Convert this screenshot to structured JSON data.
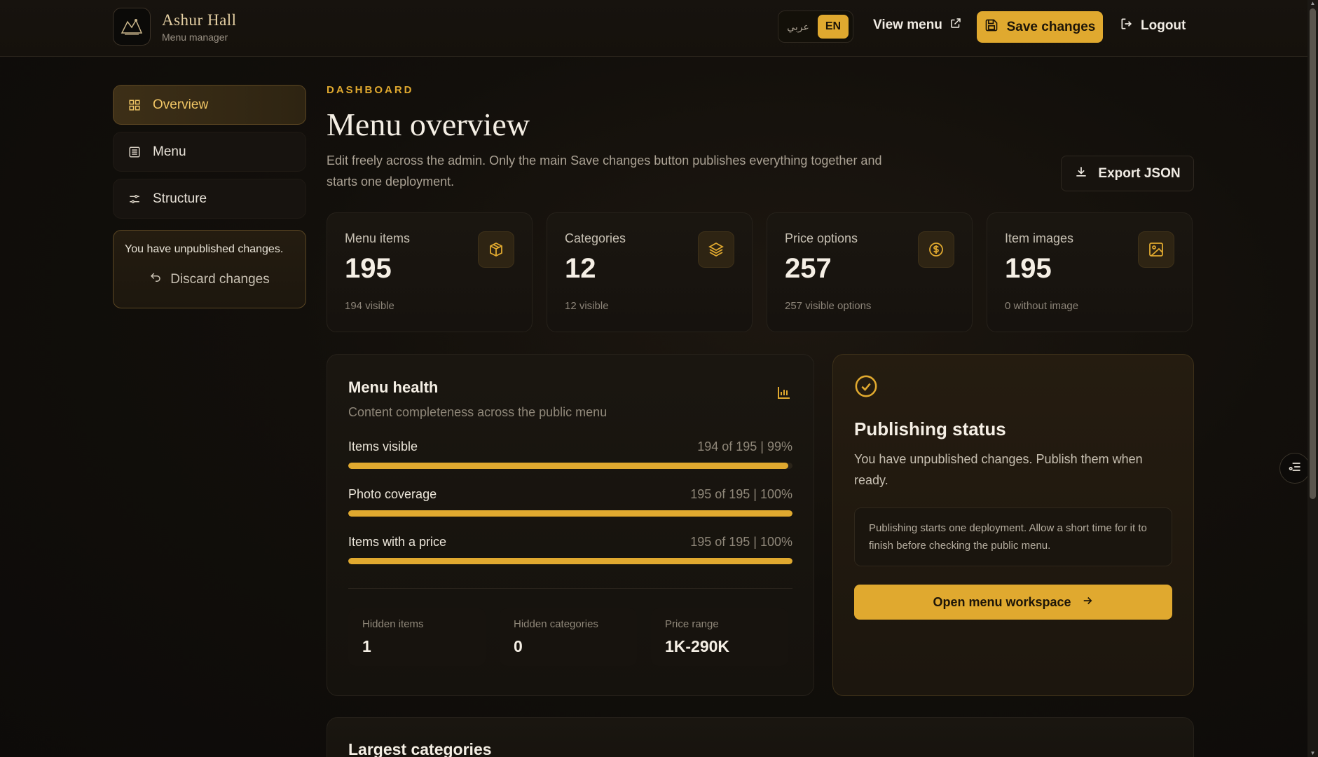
{
  "brand": {
    "name": "Ashur Hall",
    "subtitle": "Menu manager"
  },
  "header": {
    "lang_ar": "عربي",
    "lang_en": "EN",
    "view_menu": "View menu",
    "save": "Save changes",
    "logout": "Logout"
  },
  "sidebar": {
    "items": [
      {
        "label": "Overview",
        "icon": "grid-icon",
        "active": true
      },
      {
        "label": "Menu",
        "icon": "list-icon",
        "active": false
      },
      {
        "label": "Structure",
        "icon": "sliders-icon",
        "active": false
      }
    ],
    "unpublished_text": "You have unpublished changes.",
    "discard": "Discard changes"
  },
  "page": {
    "eyebrow": "DASHBOARD",
    "title": "Menu overview",
    "description": "Edit freely across the admin. Only the main Save changes button publishes everything together and starts one deployment.",
    "export": "Export JSON"
  },
  "stats": [
    {
      "label": "Menu items",
      "value": "195",
      "sub": "194 visible",
      "icon": "box-icon"
    },
    {
      "label": "Categories",
      "value": "12",
      "sub": "12 visible",
      "icon": "layers-icon"
    },
    {
      "label": "Price options",
      "value": "257",
      "sub": "257 visible options",
      "icon": "dollar-icon"
    },
    {
      "label": "Item images",
      "value": "195",
      "sub": "0 without image",
      "icon": "image-icon"
    }
  ],
  "health": {
    "title": "Menu health",
    "subtitle": "Content completeness across the public menu",
    "rows": [
      {
        "label": "Items visible",
        "value": "194 of 195 | 99%",
        "percent": 99
      },
      {
        "label": "Photo coverage",
        "value": "195 of 195 | 100%",
        "percent": 100
      },
      {
        "label": "Items with a price",
        "value": "195 of 195 | 100%",
        "percent": 100
      }
    ],
    "mini": [
      {
        "label": "Hidden items",
        "value": "1"
      },
      {
        "label": "Hidden categories",
        "value": "0"
      },
      {
        "label": "Price range",
        "value": "1K-290K"
      }
    ]
  },
  "publish": {
    "title": "Publishing status",
    "description": "You have unpublished changes. Publish them when ready.",
    "note": "Publishing starts one deployment. Allow a short time for it to finish before checking the public menu.",
    "button": "Open menu workspace"
  },
  "largest": {
    "title": "Largest categories"
  },
  "colors": {
    "accent": "#e0a92f",
    "background": "#120f0b",
    "card": "#1a1610"
  }
}
